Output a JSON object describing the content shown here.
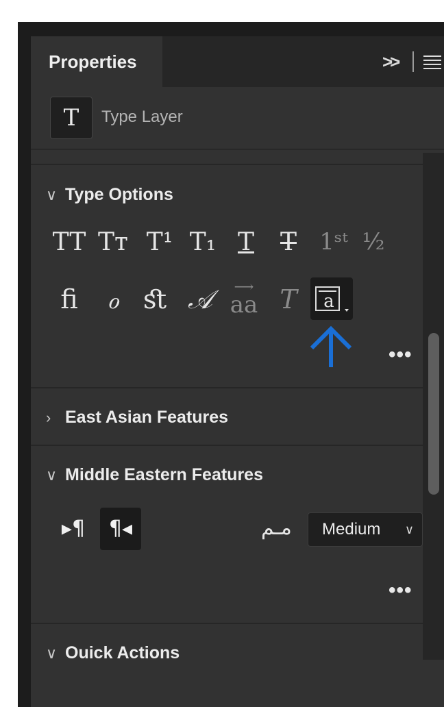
{
  "panel": {
    "tab_label": "Properties"
  },
  "layer": {
    "icon_glyph": "T",
    "label": "Type Layer"
  },
  "type_options": {
    "title": "Type Options",
    "row1": [
      "TT",
      "Tт",
      "T¹",
      "T₁",
      "T",
      "T",
      "1ˢᵗ",
      "½"
    ],
    "row2": [
      "ﬁ",
      "ℴ",
      "ﬆ",
      "𝒜",
      "aa",
      "T",
      "a"
    ],
    "more": "•••"
  },
  "east_asian": {
    "title": "East Asian Features"
  },
  "middle_eastern": {
    "title": "Middle Eastern Features",
    "ltr_glyph": "▸¶",
    "rtl_glyph": "¶◂",
    "kashida_glyph": "مـم",
    "kashida_value": "Medium",
    "more": "•••"
  },
  "quick_actions": {
    "title": "Quick Actions"
  },
  "colors": {
    "panel_bg": "#323232",
    "tabbar_bg": "#262626",
    "annotation_arrow": "#1a6fd6"
  }
}
